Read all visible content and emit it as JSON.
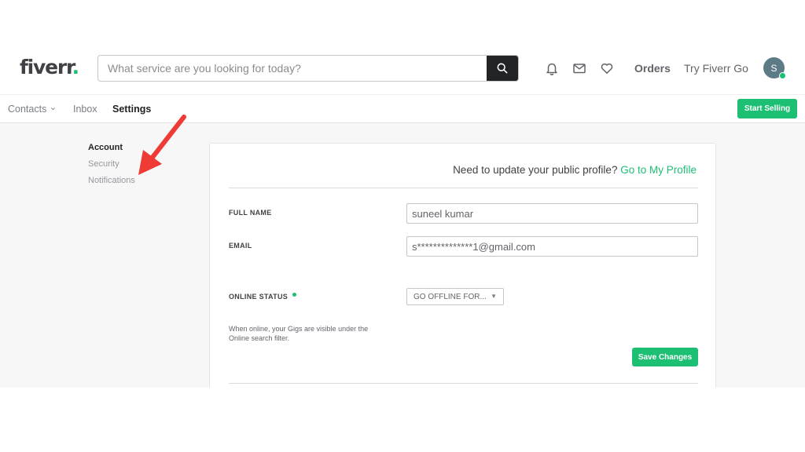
{
  "header": {
    "logo_text": "fiverr",
    "logo_dot": ".",
    "search_placeholder": "What service are you looking for today?",
    "orders_label": "Orders",
    "try_go_label": "Try Fiverr Go",
    "avatar_initial": "S"
  },
  "subnav": {
    "contacts_label": "Contacts",
    "contacts_chevron": "⌄",
    "inbox_label": "Inbox",
    "settings_label": "Settings",
    "start_selling_label": "Start Selling"
  },
  "sidebar": {
    "items": [
      {
        "label": "Account"
      },
      {
        "label": "Security"
      },
      {
        "label": "Notifications"
      }
    ]
  },
  "form": {
    "profile_prompt": "Need to update your public profile?",
    "profile_link": "Go to My Profile",
    "full_name_label": "FULL NAME",
    "full_name_value": "suneel kumar",
    "email_label": "EMAIL",
    "email_value": "s**************1@gmail.com",
    "online_status_label": "ONLINE STATUS",
    "online_status_desc": "When online, your Gigs are visible under the Online search filter.",
    "status_select_value": "GO OFFLINE FOR...",
    "status_select_arrow": "▼",
    "save_label": "Save Changes"
  },
  "colors": {
    "brand_green": "#1dbf73",
    "annotation_arrow": "#ef3a35"
  }
}
